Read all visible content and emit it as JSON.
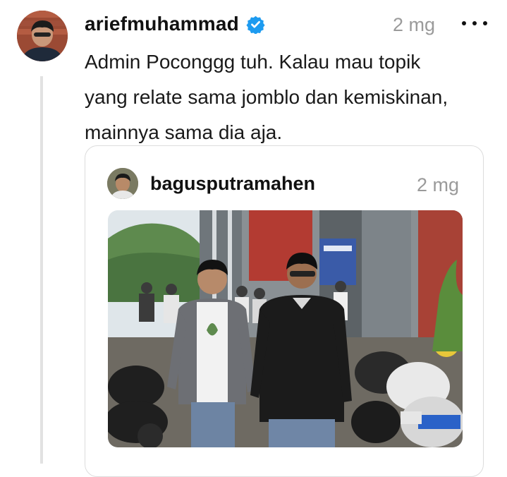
{
  "post": {
    "username": "ariefmuhammad",
    "verified_icon": "verified-badge-icon",
    "timestamp": "2 mg",
    "more_icon": "more-horizontal-icon",
    "text": "Admin Poconggg tuh. Kalau mau topik\nyang relate sama jomblo dan kemiskinan,\nmainnya sama dia aja."
  },
  "quoted_post": {
    "username": "bagusputramahen",
    "timestamp": "2 mg"
  },
  "colors": {
    "verified_blue": "#1d9bf0",
    "meta_gray": "#9a9a9a",
    "border": "#dcdcdc"
  }
}
